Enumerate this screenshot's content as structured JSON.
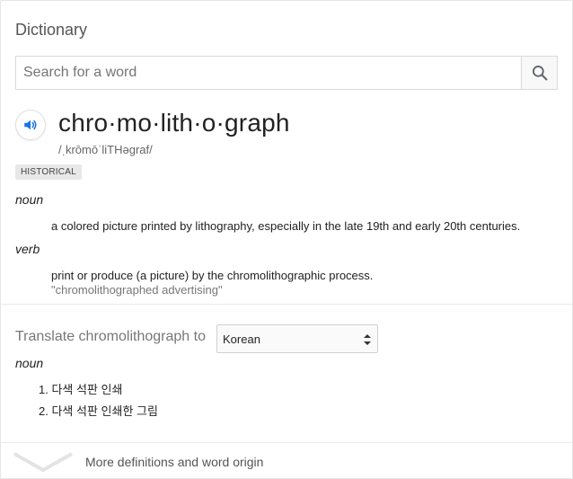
{
  "header": {
    "title": "Dictionary"
  },
  "search": {
    "placeholder": "Search for a word",
    "value": ""
  },
  "entry": {
    "headword": "chro·mo·lith·o·graph",
    "phonetic": "/ˌkrōmōˈliTHəɡraf/",
    "badge": "HISTORICAL",
    "senses": [
      {
        "pos": "noun",
        "definition": "a colored picture printed by lithography, especially in the late 19th and early 20th centuries.",
        "example": ""
      },
      {
        "pos": "verb",
        "definition": "print or produce (a picture) by the chromolithographic process.",
        "example": "\"chromolithographed advertising\""
      }
    ]
  },
  "translate": {
    "label": "Translate chromolithograph to",
    "language": "Korean",
    "pos": "noun",
    "items": [
      "다색 석판 인쇄",
      "다색 석판 인쇄한 그림"
    ],
    "numbers": [
      "1.",
      "2."
    ]
  },
  "footer": {
    "more_label": "More definitions and word origin"
  },
  "icons": {
    "search": "search-icon",
    "audio": "speaker-icon",
    "expand": "chevron-down-icon"
  },
  "colors": {
    "accent_blue": "#1a73e8",
    "badge_bg": "#e8e8e8"
  }
}
